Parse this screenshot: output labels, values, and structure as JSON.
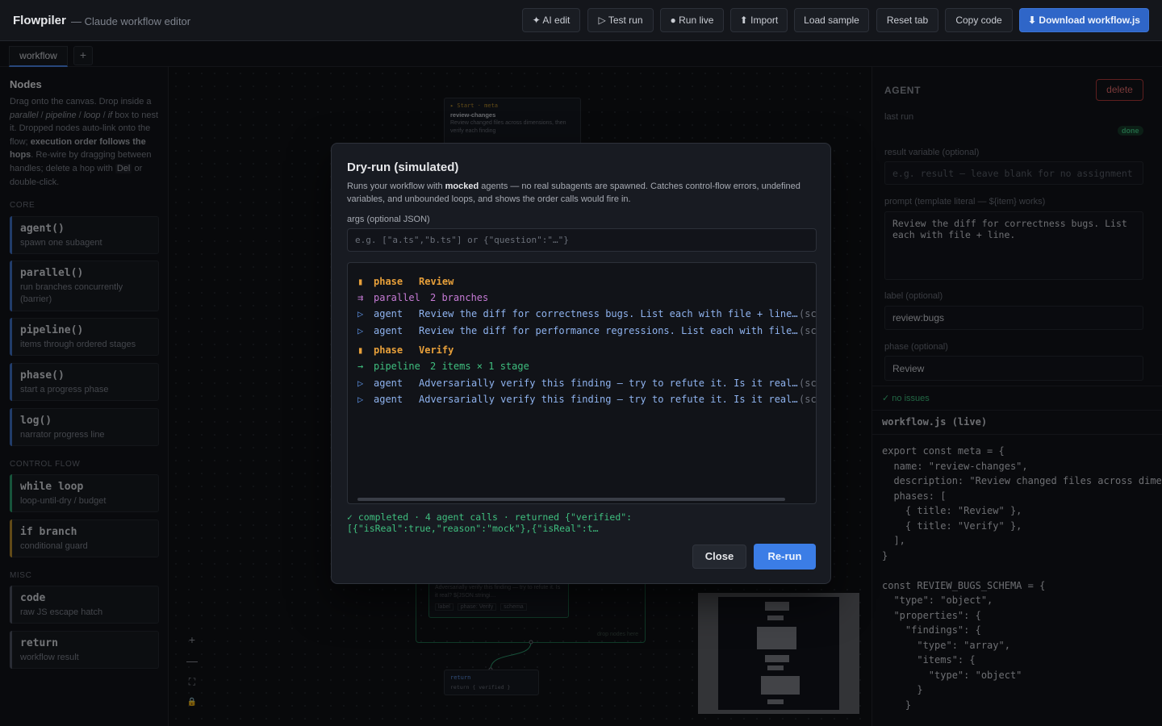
{
  "app": {
    "name": "Flowpiler",
    "subtitle": "— Claude workflow editor"
  },
  "toolbar": {
    "ai_edit": "✦ AI edit",
    "test_run": "▷ Test run",
    "run_live": "● Run live",
    "import": "⬆ Import",
    "load_sample": "Load sample",
    "reset_tab": "Reset tab",
    "copy_code": "Copy code",
    "download": "⬇ Download workflow.js"
  },
  "tabs": {
    "active": "workflow",
    "add": "+"
  },
  "sidebar": {
    "title": "Nodes",
    "sections": {
      "core": "CORE",
      "control_flow": "CONTROL FLOW",
      "misc": "MISC"
    },
    "items": [
      {
        "title": "agent()",
        "sub": "spawn one subagent"
      },
      {
        "title": "parallel()",
        "sub": "run branches concurrently (barrier)"
      },
      {
        "title": "pipeline()",
        "sub": "items through ordered stages"
      },
      {
        "title": "phase()",
        "sub": "start a progress phase"
      },
      {
        "title": "log()",
        "sub": "narrator progress line"
      },
      {
        "title": "while loop",
        "sub": "loop-until-dry / budget"
      },
      {
        "title": "if branch",
        "sub": "conditional guard"
      },
      {
        "title": "code",
        "sub": "raw JS escape hatch"
      },
      {
        "title": "return",
        "sub": "workflow result"
      }
    ]
  },
  "canvas": {
    "start_node": {
      "type": "▸ Start · meta",
      "name": "review-changes",
      "desc": "Review changed files across dimensions, then verify each finding"
    },
    "verify_node": {
      "text": "Adversarially verify this finding — try to refute it. Is it real? ${JSON.stringi…",
      "tags": [
        "label",
        "phase: Verify",
        "schema"
      ]
    },
    "drop_hint": "drop nodes here",
    "return_node": {
      "type": "return",
      "code": "return { verified }"
    },
    "controls": {
      "zoom_in": "+",
      "zoom_out": "—",
      "fit": "⛶",
      "lock": "🔒"
    }
  },
  "inspector": {
    "heading": "AGENT",
    "delete_label": "delete",
    "last_run_label": "last run",
    "last_run_status": "done",
    "result_var_label": "result variable (optional)",
    "result_var_placeholder": "e.g. result — leave blank for no assignment",
    "prompt_label": "prompt (template literal — ${item} works)",
    "prompt_value": "Review the diff for correctness bugs. List each with file + line.",
    "label_label": "label (optional)",
    "label_value": "review:bugs",
    "phase_label": "phase (optional)",
    "phase_value": "Review",
    "status": "✓ no issues",
    "code_title": "workflow.js (live)",
    "code": "export const meta = {\n  name: \"review-changes\",\n  description: \"Review changed files across dime\n  phases: [\n    { title: \"Review\" },\n    { title: \"Verify\" },\n  ],\n}\n\nconst REVIEW_BUGS_SCHEMA = {\n  \"type\": \"object\",\n  \"properties\": {\n    \"findings\": {\n      \"type\": \"array\",\n      \"items\": {\n        \"type\": \"object\"\n      }\n    }"
  },
  "modal": {
    "title": "Dry-run (simulated)",
    "desc_pre": "Runs your workflow with ",
    "desc_bold": "mocked",
    "desc_post": " agents — no real subagents are spawned. Catches control-flow errors, undefined variables, and unbounded loops, and shows the order calls would fire in.",
    "args_label": "args (optional JSON)",
    "args_placeholder": "e.g. [\"a.ts\",\"b.ts\"] or {\"question\":\"…\"}",
    "log": [
      {
        "kind": "phase",
        "icon": "▮",
        "key": "phase",
        "text": "Review",
        "sch": ""
      },
      {
        "kind": "par",
        "icon": "⇉",
        "key": "parallel",
        "text": "2 branches",
        "sch": ""
      },
      {
        "kind": "agent",
        "icon": "▷",
        "key": "agent",
        "text": "Review the diff for correctness bugs. List each with file + line…",
        "sch": "(sch"
      },
      {
        "kind": "agent",
        "icon": "▷",
        "key": "agent",
        "text": "Review the diff for performance regressions. List each with file…",
        "sch": "(sch"
      },
      {
        "kind": "phase",
        "icon": "▮",
        "key": "phase",
        "text": "Verify",
        "sch": ""
      },
      {
        "kind": "pipe",
        "icon": "→",
        "key": "pipeline",
        "text": "2 items × 1 stage",
        "sch": ""
      },
      {
        "kind": "agent",
        "icon": "▷",
        "key": "agent",
        "text": "Adversarially verify this finding — try to refute it. Is it real…",
        "sch": "(sch"
      },
      {
        "kind": "agent",
        "icon": "▷",
        "key": "agent",
        "text": "Adversarially verify this finding — try to refute it. Is it real…",
        "sch": "(sch"
      }
    ],
    "result": "✓ completed · 4 agent calls · returned {\"verified\": [{\"isReal\":true,\"reason\":\"mock\"},{\"isReal\":t…",
    "close_label": "Close",
    "rerun_label": "Re-run"
  }
}
